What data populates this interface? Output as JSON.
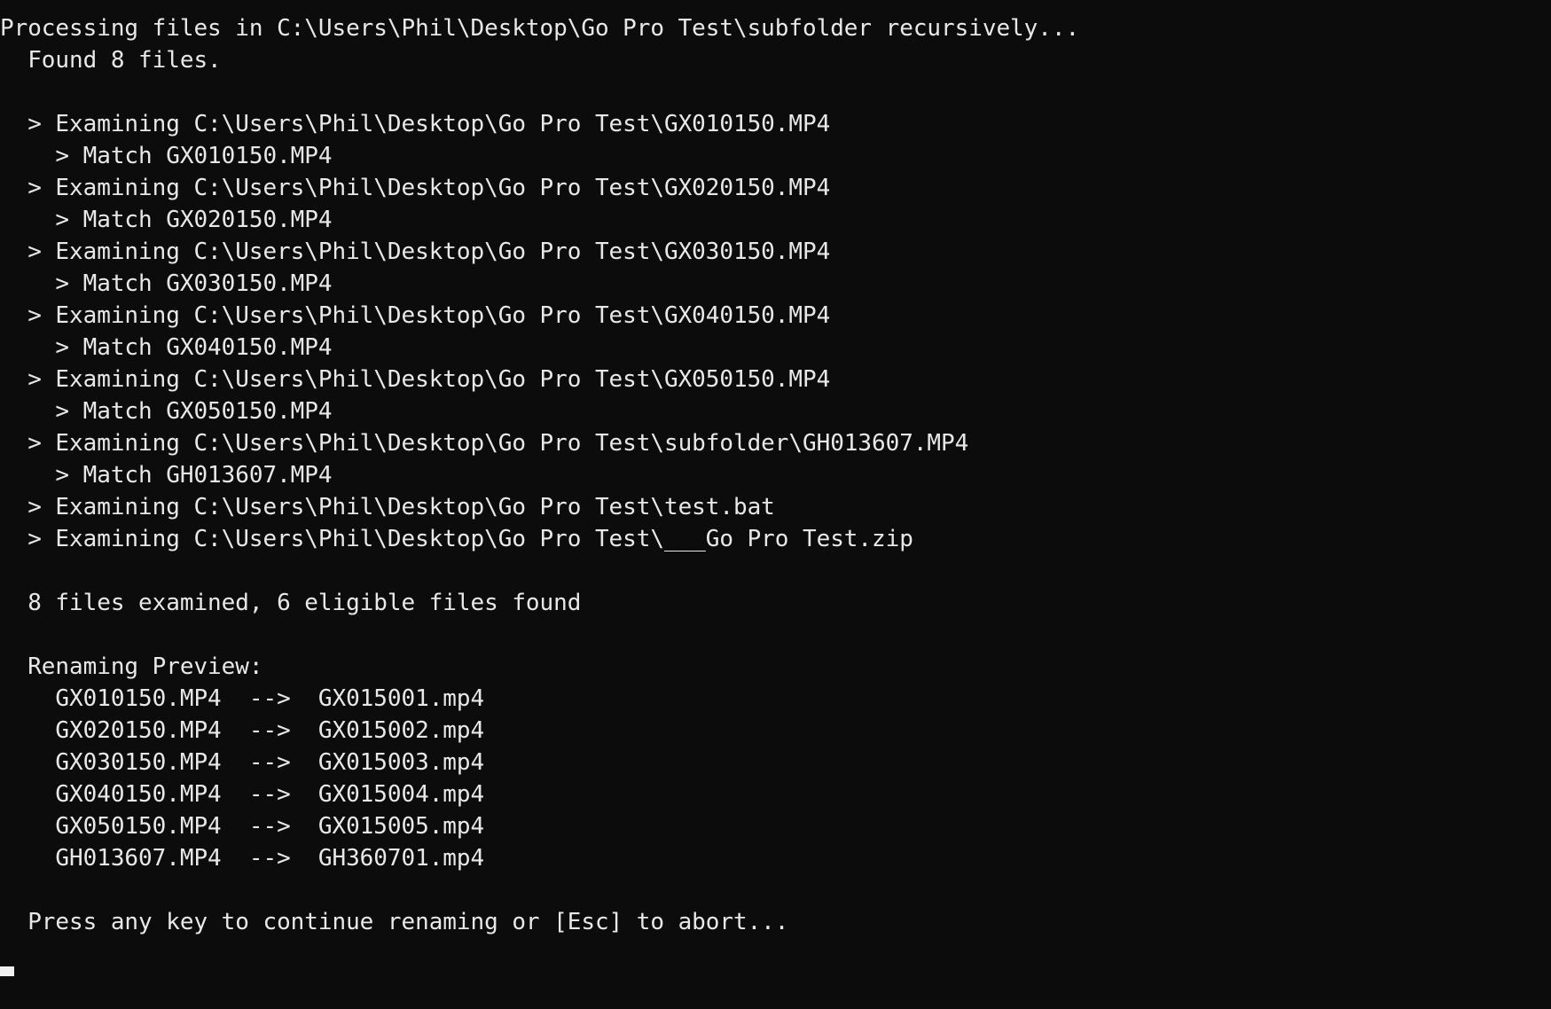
{
  "terminal": {
    "background_color": "#0c0c0c",
    "foreground_color": "#e8e8e8",
    "cursor_color": "#f0f0f0",
    "lines": [
      "Processing files in C:\\Users\\Phil\\Desktop\\Go Pro Test\\subfolder recursively...",
      "  Found 8 files.",
      "",
      "  > Examining C:\\Users\\Phil\\Desktop\\Go Pro Test\\GX010150.MP4",
      "    > Match GX010150.MP4",
      "  > Examining C:\\Users\\Phil\\Desktop\\Go Pro Test\\GX020150.MP4",
      "    > Match GX020150.MP4",
      "  > Examining C:\\Users\\Phil\\Desktop\\Go Pro Test\\GX030150.MP4",
      "    > Match GX030150.MP4",
      "  > Examining C:\\Users\\Phil\\Desktop\\Go Pro Test\\GX040150.MP4",
      "    > Match GX040150.MP4",
      "  > Examining C:\\Users\\Phil\\Desktop\\Go Pro Test\\GX050150.MP4",
      "    > Match GX050150.MP4",
      "  > Examining C:\\Users\\Phil\\Desktop\\Go Pro Test\\subfolder\\GH013607.MP4",
      "    > Match GH013607.MP4",
      "  > Examining C:\\Users\\Phil\\Desktop\\Go Pro Test\\test.bat",
      "  > Examining C:\\Users\\Phil\\Desktop\\Go Pro Test\\___Go Pro Test.zip",
      "",
      "  8 files examined, 6 eligible files found",
      "",
      "  Renaming Preview:",
      "    GX010150.MP4  -->  GX015001.mp4",
      "    GX020150.MP4  -->  GX015002.mp4",
      "    GX030150.MP4  -->  GX015003.mp4",
      "    GX040150.MP4  -->  GX015004.mp4",
      "    GX050150.MP4  -->  GX015005.mp4",
      "    GH013607.MP4  -->  GH360701.mp4",
      "",
      "  Press any key to continue renaming or [Esc] to abort...",
      ""
    ],
    "header": {
      "action": "Processing files in",
      "path": "C:\\Users\\Phil\\Desktop\\Go Pro Test\\subfolder",
      "mode": "recursively...",
      "found_text": "Found 8 files.",
      "found_count": 8
    },
    "examined": [
      {
        "path": "C:\\Users\\Phil\\Desktop\\Go Pro Test\\GX010150.MP4",
        "match": "GX010150.MP4"
      },
      {
        "path": "C:\\Users\\Phil\\Desktop\\Go Pro Test\\GX020150.MP4",
        "match": "GX020150.MP4"
      },
      {
        "path": "C:\\Users\\Phil\\Desktop\\Go Pro Test\\GX030150.MP4",
        "match": "GX030150.MP4"
      },
      {
        "path": "C:\\Users\\Phil\\Desktop\\Go Pro Test\\GX040150.MP4",
        "match": "GX040150.MP4"
      },
      {
        "path": "C:\\Users\\Phil\\Desktop\\Go Pro Test\\GX050150.MP4",
        "match": "GX050150.MP4"
      },
      {
        "path": "C:\\Users\\Phil\\Desktop\\Go Pro Test\\subfolder\\GH013607.MP4",
        "match": "GH013607.MP4"
      },
      {
        "path": "C:\\Users\\Phil\\Desktop\\Go Pro Test\\test.bat",
        "match": null
      },
      {
        "path": "C:\\Users\\Phil\\Desktop\\Go Pro Test\\___Go Pro Test.zip",
        "match": null
      }
    ],
    "summary": {
      "text": "8 files examined, 6 eligible files found",
      "examined_count": 8,
      "eligible_count": 6
    },
    "preview": {
      "title": "Renaming Preview:",
      "arrow": "-->",
      "rows": [
        {
          "from": "GX010150.MP4",
          "to": "GX015001.mp4"
        },
        {
          "from": "GX020150.MP4",
          "to": "GX015002.mp4"
        },
        {
          "from": "GX030150.MP4",
          "to": "GX015003.mp4"
        },
        {
          "from": "GX040150.MP4",
          "to": "GX015004.mp4"
        },
        {
          "from": "GX050150.MP4",
          "to": "GX015005.mp4"
        },
        {
          "from": "GH013607.MP4",
          "to": "GH360701.mp4"
        }
      ]
    },
    "prompt": "Press any key to continue renaming or [Esc] to abort..."
  }
}
